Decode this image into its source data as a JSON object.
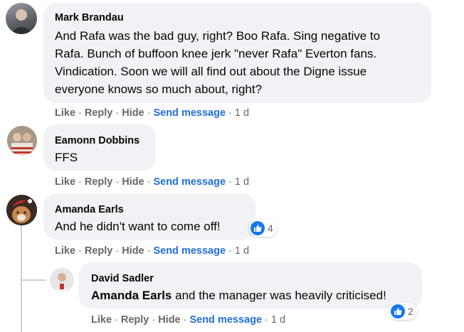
{
  "comments": [
    {
      "author": "Mark Brandau",
      "lines": [
        "And Rafa was the bad guy, right? Boo Rafa. Sing negative to",
        "Rafa. Bunch of buffoon knee jerk \"never Rafa\" Everton fans.",
        "Vindication. Soon we will all find out about the Digne issue",
        "everyone knows so much about, right?"
      ],
      "actions": {
        "like": "Like",
        "reply": "Reply",
        "hide": "Hide",
        "send": "Send message",
        "time": "1 d"
      }
    },
    {
      "author": "Eamonn Dobbins",
      "lines": [
        "FFS"
      ],
      "actions": {
        "like": "Like",
        "reply": "Reply",
        "hide": "Hide",
        "send": "Send message",
        "time": "1 d"
      }
    },
    {
      "author": "Amanda Earls",
      "lines": [
        "And he didn't want to come off!"
      ],
      "reaction_count": "4",
      "actions": {
        "like": "Like",
        "reply": "Reply",
        "hide": "Hide",
        "send": "Send message",
        "time": "1 d"
      }
    },
    {
      "author": "David Sadler",
      "mention": "Amanda Earls",
      "text": " and the manager was heavily criticised!",
      "reaction_count": "2",
      "actions": {
        "like": "Like",
        "reply": "Reply",
        "hide": "Hide",
        "send": "Send message",
        "time": "1 d"
      }
    }
  ],
  "separator": "·",
  "colors": {
    "bubble": "#f0f2f5",
    "link": "#216fdb",
    "muted": "#65676b",
    "like_blue": "#1877f2"
  },
  "icons": [
    "avatar",
    "thumbs-up-icon"
  ]
}
